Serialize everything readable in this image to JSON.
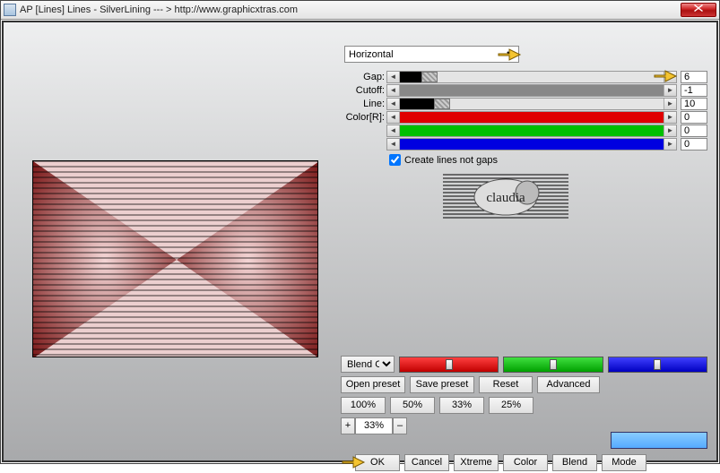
{
  "titlebar": {
    "title": "AP [Lines]  Lines - SilverLining    --- > http://www.graphicxtras.com"
  },
  "dropdown": {
    "selected": "Horizontal"
  },
  "sliders": {
    "gap": {
      "label": "Gap:",
      "value": "6"
    },
    "cutoff": {
      "label": "Cutoff:",
      "value": "-1"
    },
    "line": {
      "label": "Line:",
      "value": "10"
    },
    "r": {
      "label": "Color[R]:",
      "value": "0"
    },
    "g": {
      "label": "",
      "value": "0"
    },
    "b": {
      "label": "",
      "value": "0"
    }
  },
  "checkbox": {
    "label": "Create lines not gaps",
    "checked": true
  },
  "logo": {
    "text": "claudia"
  },
  "blend": {
    "label": "Blend Options"
  },
  "presetRow": {
    "open": "Open preset",
    "save": "Save preset",
    "reset": "Reset",
    "advanced": "Advanced"
  },
  "pctRow": {
    "p100": "100%",
    "p50": "50%",
    "p33": "33%",
    "p25": "25%"
  },
  "zoom": {
    "plus": "+",
    "value": "33%",
    "minus": "–"
  },
  "finalRow": {
    "ok": "OK",
    "cancel": "Cancel",
    "xtreme": "Xtreme",
    "color": "Color",
    "blend": "Blend",
    "mode": "Mode"
  }
}
